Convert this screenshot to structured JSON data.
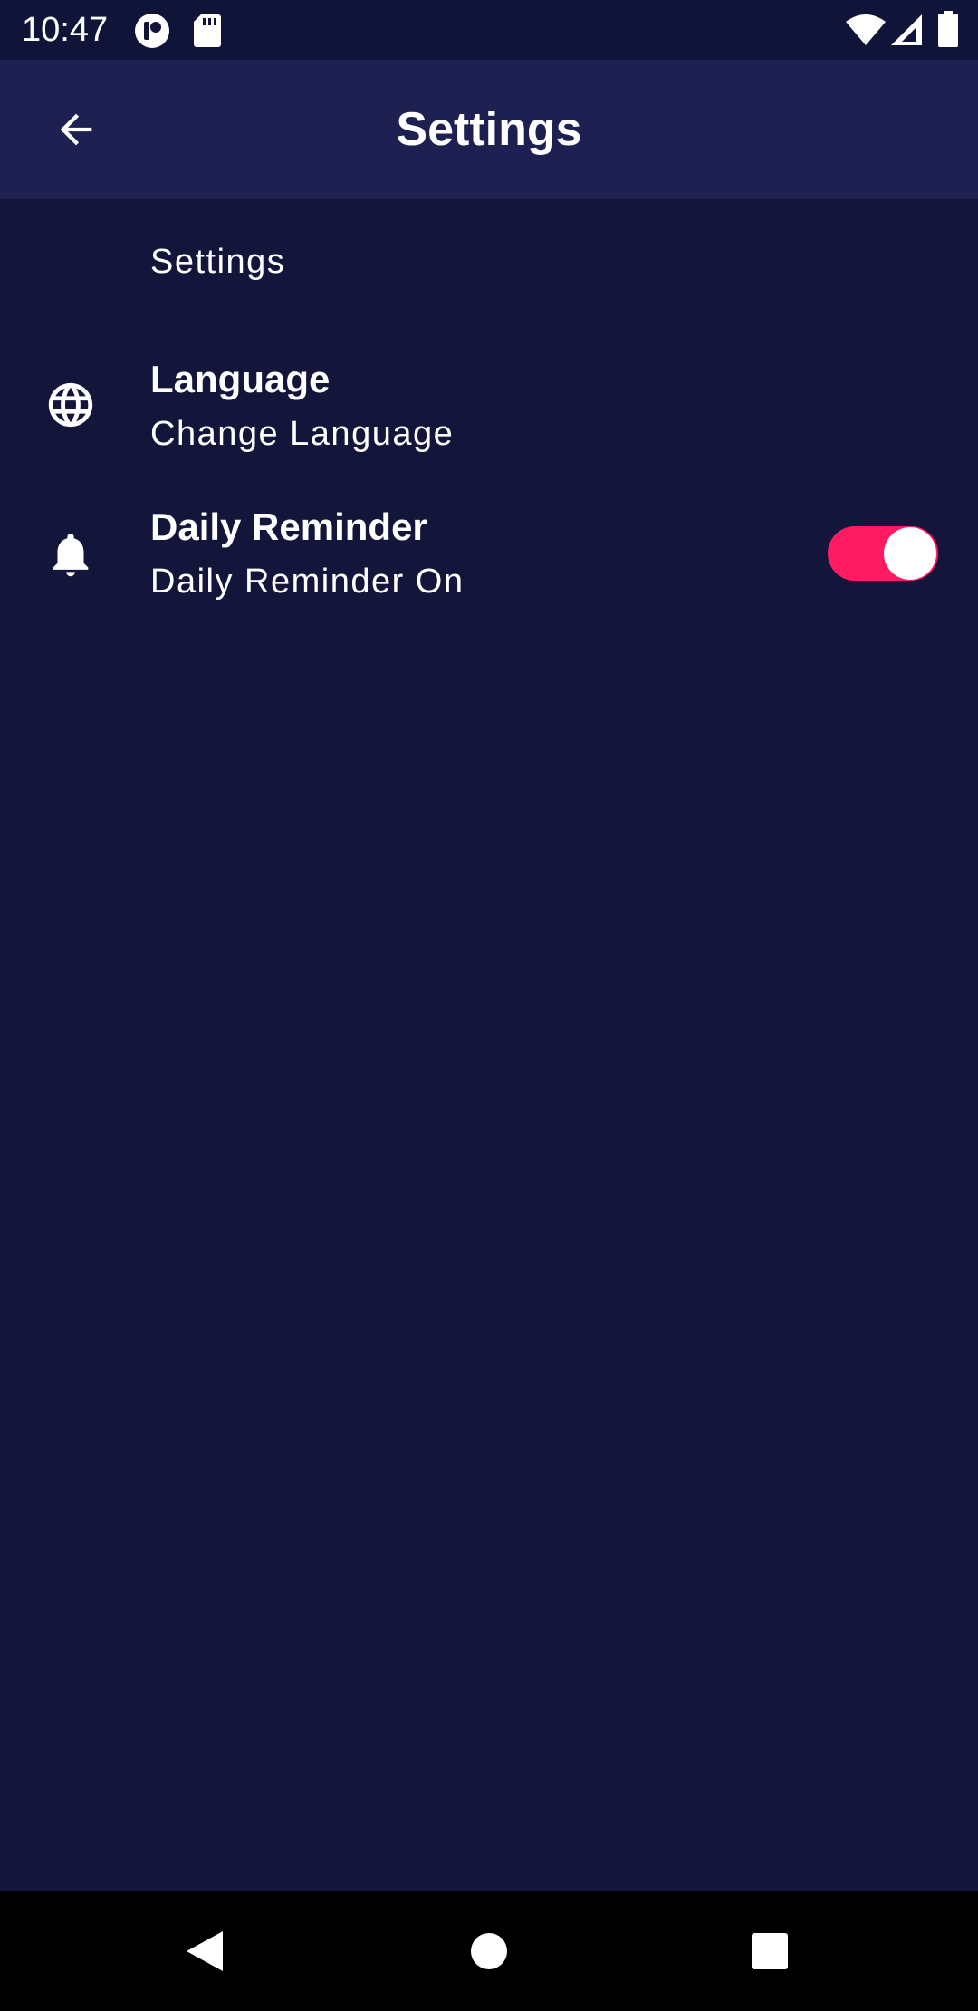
{
  "status_bar": {
    "time": "10:47",
    "icons": [
      "notification-app-icon",
      "sd-card-icon",
      "wifi-icon",
      "cell-signal-icon",
      "battery-icon"
    ]
  },
  "app_bar": {
    "title": "Settings",
    "back_icon": "arrow-back-icon"
  },
  "section": {
    "header": "Settings"
  },
  "preferences": [
    {
      "icon": "globe-icon",
      "title": "Language",
      "summary": "Change Language"
    },
    {
      "icon": "bell-icon",
      "title": "Daily Reminder",
      "summary": "Daily Reminder On",
      "switch_on": true
    }
  ],
  "nav_bar": {
    "icons": [
      "back-triangle-icon",
      "home-circle-icon",
      "recents-square-icon"
    ]
  },
  "colors": {
    "background": "#13163a",
    "status_bar": "#111439",
    "app_bar": "#1d2050",
    "accent": "#ff1a62",
    "text": "#ffffff",
    "nav_bar": "#000000"
  }
}
